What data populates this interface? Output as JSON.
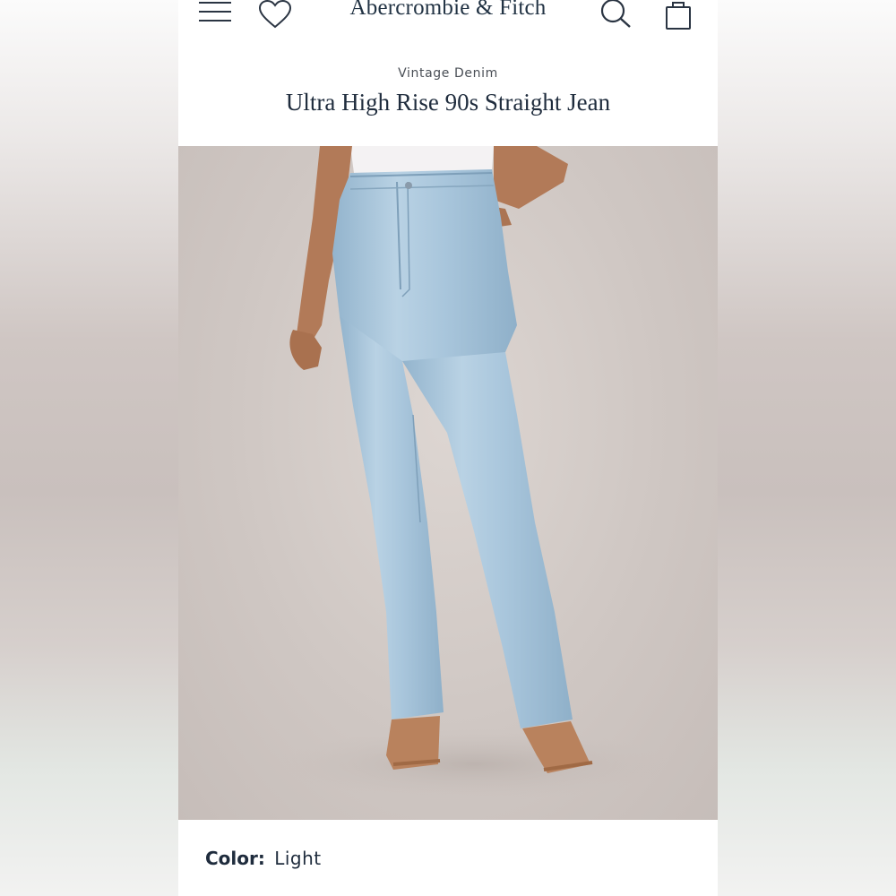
{
  "header": {
    "brand": "Abercrombie & Fitch",
    "icons": [
      "menu-icon",
      "heart-icon",
      "search-icon",
      "shopping-bag-icon"
    ]
  },
  "product": {
    "collection": "Vintage Denim",
    "title": "Ultra High Rise 90s Straight Jean",
    "color_label": "Color:",
    "color_value": "Light"
  },
  "colors": {
    "text_primary": "#1f2c3d",
    "denim": "#aecbe0",
    "background": "#ffffff"
  }
}
